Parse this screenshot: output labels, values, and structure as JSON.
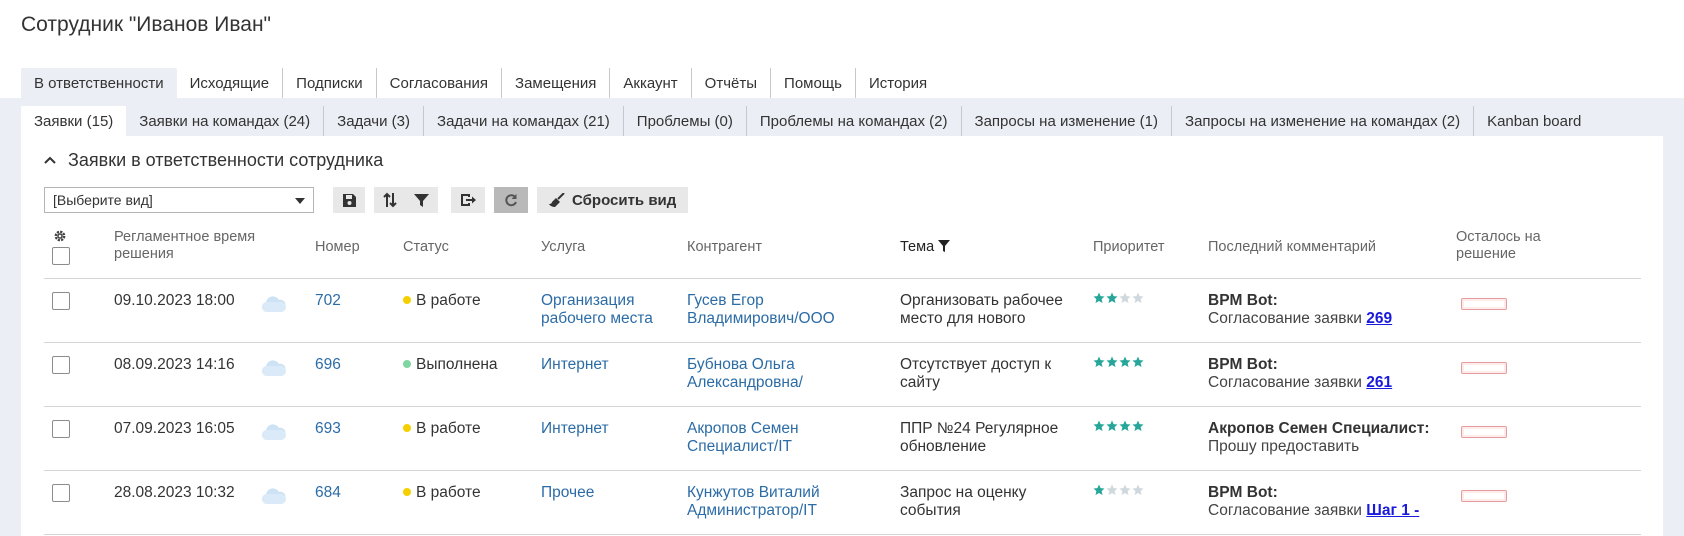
{
  "page": {
    "title": "Сотрудник \"Иванов Иван\""
  },
  "main_tabs": [
    {
      "label": "В ответственности"
    },
    {
      "label": "Исходящие"
    },
    {
      "label": "Подписки"
    },
    {
      "label": "Согласования"
    },
    {
      "label": "Замещения"
    },
    {
      "label": "Аккаунт"
    },
    {
      "label": "Отчёты"
    },
    {
      "label": "Помощь"
    },
    {
      "label": "История"
    }
  ],
  "sub_tabs": [
    {
      "label": "Заявки (15)"
    },
    {
      "label": "Заявки на командах (24)"
    },
    {
      "label": "Задачи (3)"
    },
    {
      "label": "Задачи на командах (21)"
    },
    {
      "label": "Проблемы (0)"
    },
    {
      "label": "Проблемы на командах (2)"
    },
    {
      "label": "Запросы на изменение (1)"
    },
    {
      "label": "Запросы на изменение на командах (2)"
    },
    {
      "label": "Kanban board"
    }
  ],
  "section": {
    "title": "Заявки в ответственности сотрудника"
  },
  "toolbar": {
    "view_select_value": "[Выберите вид]",
    "reset_label": "Сбросить вид"
  },
  "columns": {
    "deadline": "Регламентное время решения",
    "number": "Номер",
    "status": "Статус",
    "service": "Услуга",
    "contractor": "Контрагент",
    "subject": "Тема",
    "priority": "Приоритет",
    "last_comment": "Последний комментарий",
    "remaining": "Осталось на решение"
  },
  "colors": {
    "in_work": "#f5d000",
    "done": "#7ed6a3",
    "star_on": "#26a69a",
    "star_off": "#cfd8dc"
  },
  "rows": [
    {
      "deadline": "09.10.2023 18:00",
      "number": "702",
      "status": "В работе",
      "status_color": "#f5d000",
      "service_l1": "Организация",
      "service_l2": "рабочего места",
      "contractor_l1": "Гусев Егор",
      "contractor_l2": "Владимирович/ООО",
      "subject_l1": "Организовать рабочее",
      "subject_l2": "место для нового",
      "priority": 2,
      "comment_author": "BPM Bot:",
      "comment_text": "Согласование заявки ",
      "comment_link": "269"
    },
    {
      "deadline": "08.09.2023 14:16",
      "number": "696",
      "status": "Выполнена",
      "status_color": "#7ed6a3",
      "service_l1": "Интернет",
      "service_l2": "",
      "contractor_l1": "Бубнова Ольга",
      "contractor_l2": "Александровна/",
      "subject_l1": "Отсутствует доступ к",
      "subject_l2": "сайту",
      "priority": 4,
      "comment_author": "BPM Bot:",
      "comment_text": "Согласование заявки ",
      "comment_link": "261"
    },
    {
      "deadline": "07.09.2023 16:05",
      "number": "693",
      "status": "В работе",
      "status_color": "#f5d000",
      "service_l1": "Интернет",
      "service_l2": "",
      "contractor_l1": "Акропов Семен",
      "contractor_l2": "Специалист/IT",
      "subject_l1": "ППР №24 Регулярное",
      "subject_l2": "обновление",
      "priority": 4,
      "comment_author": "Акропов Семен Специалист:",
      "comment_text": "Прошу предоставить",
      "comment_link": ""
    },
    {
      "deadline": "28.08.2023 10:32",
      "number": "684",
      "status": "В работе",
      "status_color": "#f5d000",
      "service_l1": "Прочее",
      "service_l2": "",
      "contractor_l1": "Кунжутов Виталий",
      "contractor_l2": "Администратор/IT",
      "subject_l1": "Запрос на оценку",
      "subject_l2": "события",
      "priority": 1,
      "comment_author": "BPM Bot:",
      "comment_text": "Согласование заявки ",
      "comment_link": "Шаг 1 -"
    }
  ]
}
